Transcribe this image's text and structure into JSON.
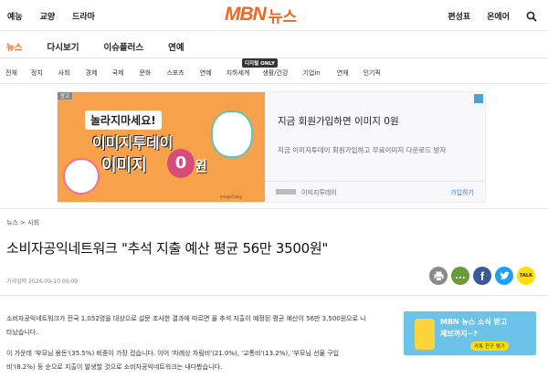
{
  "top": {
    "links": [
      "예능",
      "교양",
      "드라마"
    ],
    "logo_mbn": "MBN",
    "logo_news": "뉴스",
    "right_links": [
      "편성표",
      "온에어"
    ]
  },
  "mainnav": [
    "뉴스",
    "다시보기",
    "이슈플러스",
    "연예"
  ],
  "catnav": {
    "items": [
      "전체",
      "정치",
      "사회",
      "경제",
      "국제",
      "문화",
      "스포츠",
      "연예",
      "지하세계",
      "생활/건강",
      "기업in",
      "연재",
      "인기픽"
    ],
    "badge": "디지털 ONLY"
  },
  "ad": {
    "label": "광고",
    "image_line1": "놀라지마세요!",
    "image_line2": "이미지투데이",
    "image_line3": "이미지",
    "image_coin": "0",
    "image_won": "원",
    "image_brand": "ImageToday",
    "headline": "지금 회원가입하면 이미지 0원",
    "description": "지금 이미지투데이 회원가입하고 무료이미지 다운로드 받자",
    "source": "이미지투데이",
    "cta": "가입하기"
  },
  "breadcrumb": "뉴스 > 사회",
  "article": {
    "title": "소비자공익네트워크 \"추석 지출 예산 평균 56만 3500원\"",
    "date": "기사입력 2024-09-10 00:09",
    "paragraphs": [
      "소비자공익네트워크가 전국 1,052명을 대상으로 설문 조사한 결과에 따르면 올 추석 지출이 예정된 평균 예산이 56만 3,500원으로 나타났습니다.",
      "이 가운데 '부모님 용돈'(35.5%) 비중이 가장 컸습니다. 이어 '차례상 차림비'(21.0%), '교통비'(13.2%), '부모님 선물 구입비'(8.2%) 등 순으로 지출이 발생할 것으로 소비자공익네트워크는 내다봤습니다."
    ]
  },
  "share": [
    "print",
    "comment",
    "facebook",
    "twitter",
    "kakao"
  ],
  "share_labels": {
    "comment": "...",
    "facebook": "f",
    "twitter": "t",
    "kakao": "TALK"
  },
  "side_ad": {
    "line1": "MBN 뉴스 소식 받고",
    "line2": "제보까지~?",
    "button": "카톡 친구 맺기"
  },
  "colors": {
    "brand": "#f26522",
    "facebook": "#3b5998",
    "twitter": "#1da1f2",
    "kakao": "#ffe000",
    "comment": "#6c9a3a",
    "print": "#8a8a8a"
  }
}
